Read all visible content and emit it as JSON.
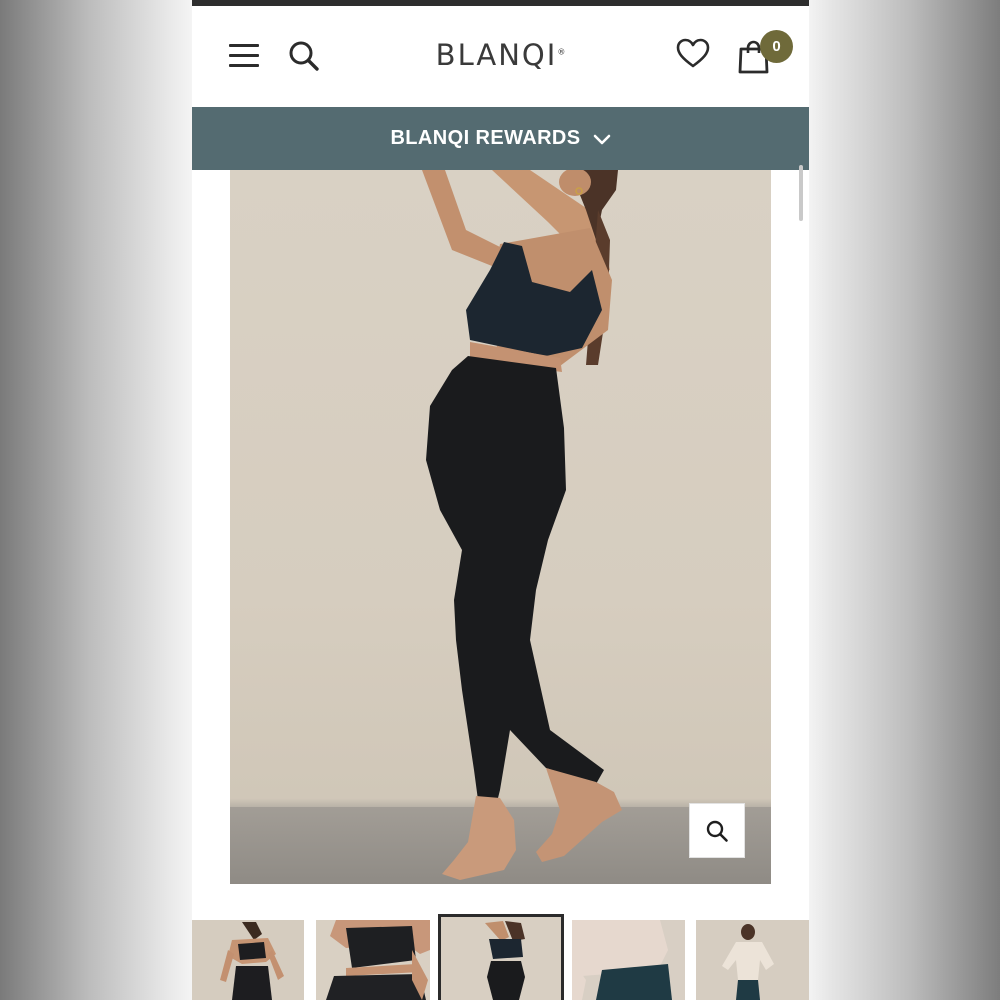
{
  "header": {
    "logo": "BLANQI",
    "logo_mark": "®",
    "cart_count": "0",
    "icons": {
      "menu": "hamburger-menu-icon",
      "search": "search-icon",
      "wishlist": "heart-icon",
      "cart": "shopping-bag-icon"
    }
  },
  "rewards": {
    "label": "BLANQI REWARDS",
    "icon": "chevron-down-icon"
  },
  "gallery": {
    "main_image": "pregnant model in black sports bra and black maternity leggings, standing on tiptoe",
    "zoom_icon": "search-icon",
    "thumbnails": [
      {
        "name": "thumbnail-1",
        "active": false
      },
      {
        "name": "thumbnail-2",
        "active": false
      },
      {
        "name": "thumbnail-3",
        "active": true
      },
      {
        "name": "thumbnail-4",
        "active": false
      },
      {
        "name": "thumbnail-5",
        "active": false
      }
    ]
  },
  "colors": {
    "rewards_bar": "#546b71",
    "badge": "#6f6a3a",
    "text_dark": "#2b2b2b"
  }
}
